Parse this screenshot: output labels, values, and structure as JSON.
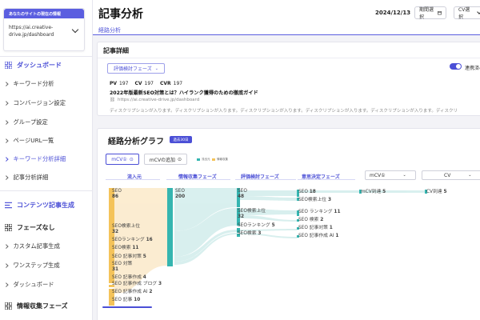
{
  "sidebar": {
    "site_header": "あなたのサイトの現在の情報",
    "site_url_line1": "https://ai.creative-",
    "site_url_line2": "drive.jp/dashboard",
    "dashboard": "ダッシュボード",
    "items_top": [
      "キーワード分析",
      "コンバージョン設定",
      "グループ設定",
      "ページURL一覧",
      "キーワード分析詳細",
      "記事分析詳細"
    ],
    "content_gen": "コンテンツ記事生成",
    "phase_none": "フェーズなし",
    "items_bottom": [
      "カスタム記事生成",
      "ワンステップ生成",
      "ダッシュボード"
    ],
    "info_phase": "情報収集フェーズ"
  },
  "header": {
    "title": "記事分析",
    "date": "2024/12/13",
    "period_button": "期間選択",
    "cv_select": "CV選択",
    "breadcrumb": "経路分析"
  },
  "article": {
    "section_title": "記事詳細",
    "phase_button": "評価検討フェーズ",
    "toggle_label": "連携済み",
    "pv_label": "PV",
    "pv": "197",
    "cv_label": "CV",
    "cv": "197",
    "cvr_label": "CVR",
    "cvr": "197",
    "title": "2022年版最新SEO対策とは？ハイランク獲得のための徹底ガイド",
    "url": "https://ai.creative-drive.jp/dashboard",
    "description": "ディスクリプションが入ります。ディスクリプションが入ります。ディスクリプションが入ります。ディスクリプションが入ります。ディスクリプションが入ります。ディスクリ"
  },
  "graph": {
    "title": "経路分析グラフ",
    "badge": "過去30日",
    "tab_mcv": "mCV①",
    "tab_add": "mCVの追加",
    "legend_source": "流出元",
    "legend_phase": "情報収集",
    "columns": {
      "inflow": "流入元",
      "info": "情報収集フェーズ",
      "eval": "評価検討フェーズ",
      "decision": "意思決定フェーズ",
      "mcv": "mCV①",
      "cv": "CV"
    },
    "colors": {
      "inflow": "#f4c35a",
      "info": "#35b5b0",
      "accent": "#4b4fd6"
    }
  },
  "sankey": {
    "inflow": [
      {
        "label": "SEO",
        "value": "86"
      },
      {
        "label": "SEO検索上位",
        "value": "32"
      },
      {
        "label": "SEOランキング",
        "value": "16"
      },
      {
        "label": "SEO検索",
        "value": "11"
      },
      {
        "label": "SEO 記事対策",
        "value": "5"
      },
      {
        "label": "SEO 対策",
        "value": "31"
      },
      {
        "label": "SEO 記事作成",
        "value": "4"
      },
      {
        "label": "SEO 記事作成 ブログ",
        "value": "3"
      },
      {
        "label": "SEO 記事作成 AI",
        "value": "2"
      },
      {
        "label": "SEO 記事",
        "value": "10"
      }
    ],
    "info": [
      {
        "label": "SEO",
        "value": "200"
      }
    ],
    "eval": [
      {
        "label": "SEO",
        "value": "48"
      },
      {
        "label": "SEO検索上位",
        "value": "32"
      },
      {
        "label": "SEOランキング",
        "value": "5"
      },
      {
        "label": "SEO検索",
        "value": "3"
      }
    ],
    "decision": [
      {
        "label": "SEO",
        "value": "18"
      },
      {
        "label": "SEO検索上位",
        "value": "3"
      },
      {
        "label": "SEO ランキング",
        "value": "11"
      },
      {
        "label": "SEO 検索",
        "value": "2"
      },
      {
        "label": "SEO 記事対策",
        "value": "1"
      },
      {
        "label": "SEO 記事作成 AI",
        "value": "1"
      }
    ],
    "mcv": [
      {
        "label": "mCV到達",
        "value": "5"
      }
    ],
    "cv": [
      {
        "label": "CV到達",
        "value": "5"
      }
    ]
  }
}
